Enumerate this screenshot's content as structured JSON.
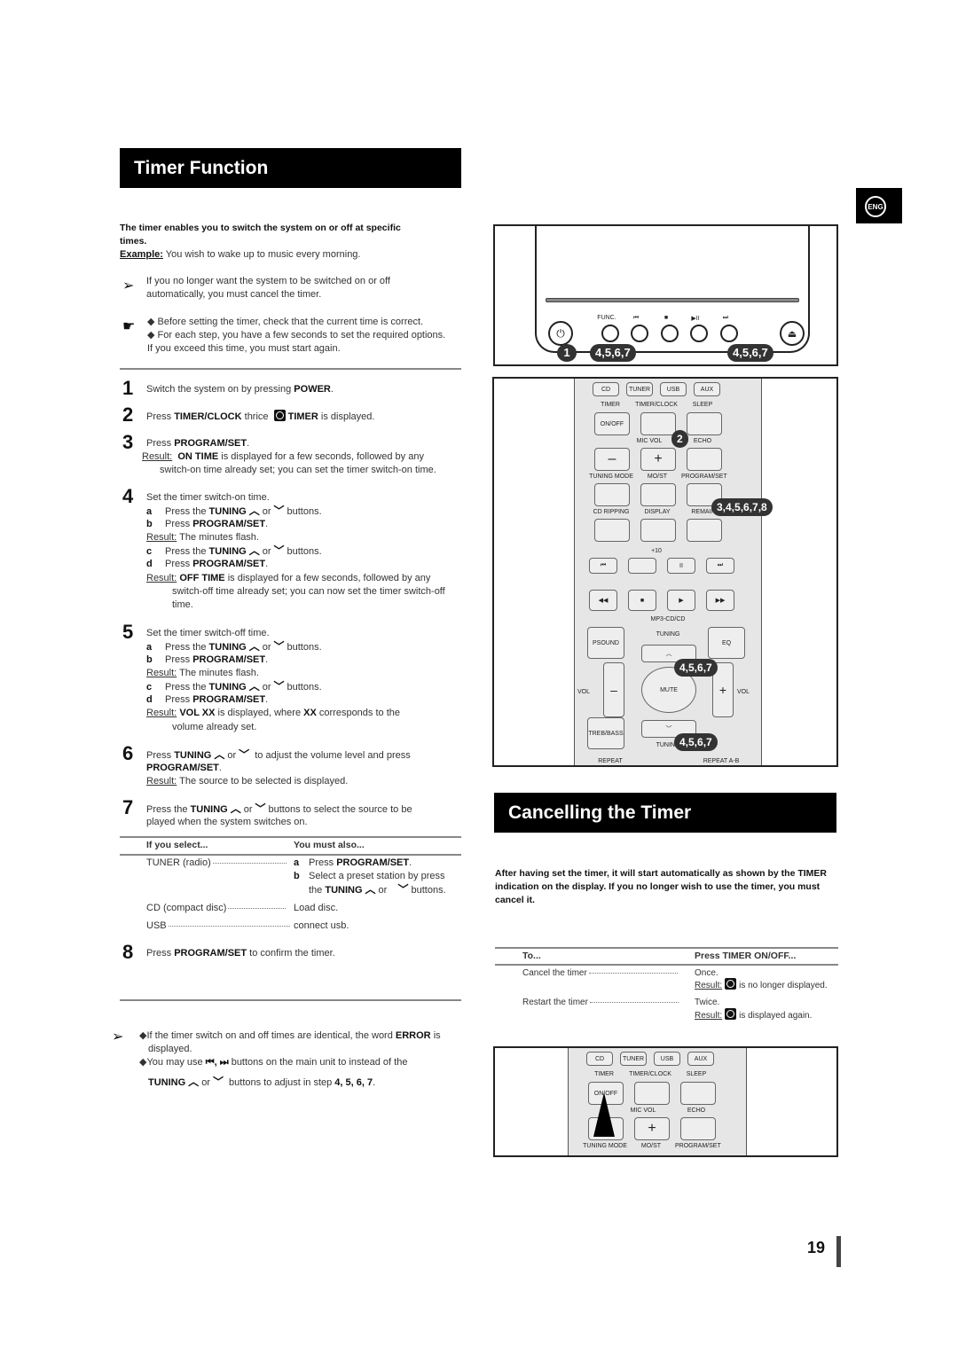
{
  "timer_function": {
    "title": "Timer Function",
    "intro_bold": "The timer enables you to switch the system on or off at specific times.",
    "example_label": "Example:",
    "example_text": "You wish to wake up to music every morning.",
    "note_cancel": "If you no longer want the system to be switched on or off automatically, you must cancel the timer.",
    "tip_1": "Before setting the timer, check that the current time is correct.",
    "tip_2": "For each step, you have a few seconds to set the required options.",
    "tip_3": "If you exceed this time, you must start again.",
    "steps": {
      "s1": {
        "num": "1",
        "text_a": "Switch the system on by pressing ",
        "bold": "POWER",
        "text_b": "."
      },
      "s2": {
        "num": "2",
        "text_a": "Press ",
        "bold": "TIMER/CLOCK",
        "text_b": " thrice ",
        "bold2": "TIMER",
        "text_c": " is displayed."
      },
      "s3": {
        "num": "3",
        "text_a": "Press ",
        "bold": "PROGRAM/SET",
        "text_b": ".",
        "result_label": "Result:",
        "result_bold": "ON TIME",
        "result_text": " is displayed for a few seconds, followed by any",
        "result_text2": "switch-on time already set; you can set the timer switch-on time."
      },
      "s4": {
        "num": "4",
        "heading": "Set the timer switch-on time.",
        "a": "Press the ",
        "a_bold": "TUNING",
        "a_or": "or",
        "a_end": "buttons.",
        "b": "Press ",
        "b_bold": "PROGRAM/SET",
        "b_end": ".",
        "r1_label": "Result:",
        "r1_text": "The minutes flash.",
        "c": "Press the ",
        "c_bold": "TUNING",
        "c_or": "or",
        "c_end": "buttons.",
        "d": "Press ",
        "d_bold": "PROGRAM/SET",
        "d_end": ".",
        "r2_label": "Result:",
        "r2_bold": "OFF TIME",
        "r2_text": " is displayed for a few seconds, followed by any",
        "r2_text2": "switch-off time already set; you can now set the timer switch-off",
        "r2_text3": "time."
      },
      "s5": {
        "num": "5",
        "heading": "Set the timer switch-off time.",
        "a": "Press the ",
        "a_bold": "TUNING",
        "a_or": "or",
        "a_end": "buttons.",
        "b": "Press ",
        "b_bold": "PROGRAM/SET",
        "b_end": ".",
        "r1_label": "Result:",
        "r1_text": "The minutes flash.",
        "c": "Press the ",
        "c_bold": "TUNING",
        "c_or": "or",
        "c_end": "buttons.",
        "d": "Press ",
        "d_bold": "PROGRAM/SET",
        "d_end": ".",
        "r2_label": "Result:",
        "r2_bold": "VOL XX",
        "r2_text": " is displayed, where ",
        "r2_bold2": "XX",
        "r2_text_b": " corresponds to the",
        "r2_text2": "volume already set."
      },
      "s6": {
        "num": "6",
        "text_a": "Press ",
        "bold": "TUNING",
        "or": "or",
        "text_b": "to adjust the volume level and press",
        "bold2": "PROGRAM/SET",
        "text_c": ".",
        "result_label": "Result:",
        "result_text": "The source to be selected is displayed."
      },
      "s7": {
        "num": "7",
        "text_a": "Press the ",
        "bold": "TUNING",
        "or": "or",
        "text_b": "buttons to select the source to be",
        "text_c": "played when the system switches on."
      },
      "s8": {
        "num": "8",
        "text_a": "Press ",
        "bold": "PROGRAM/SET",
        "text_b": " to confirm the timer."
      }
    },
    "source_table": {
      "headers": [
        "If you select...",
        "You must also..."
      ],
      "rows": [
        {
          "source": "TUNER (radio)",
          "a_label": "a",
          "a_text": "Press ",
          "a_bold": "PROGRAM/SET",
          "a_end": ".",
          "b_label": "b",
          "b_text": "Select a preset station by press",
          "b_text2_a": "the ",
          "b_bold": "TUNING",
          "b_or": "or",
          "b_end": "buttons."
        },
        {
          "source": "CD (compact disc)",
          "action": "Load disc."
        },
        {
          "source": "USB",
          "action": "connect usb."
        }
      ]
    },
    "footnote_1a": "If the timer switch on and off times are identical, the word ",
    "footnote_1b": "ERROR",
    "footnote_1c": " is",
    "footnote_1d": "displayed.",
    "footnote_2a": "You may use ",
    "footnote_2_icons": "⏮, ⏭",
    "footnote_2b": " buttons on the main unit to instead of the",
    "footnote_3_bold": "TUNING",
    "footnote_3_or": "or",
    "footnote_3b": "buttons to adjust in step ",
    "footnote_3_steps": "4, 5, 6, 7",
    "footnote_3_end": "."
  },
  "language_tab": "ENG",
  "main_unit_figure": {
    "labels": [
      "FUNC.",
      "⏮",
      "■",
      "▶II",
      "⏭"
    ],
    "badges": [
      "1",
      "4,5,6,7",
      "4,5,6,7"
    ]
  },
  "remote_figure": {
    "row1": [
      "CD",
      "TUNER",
      "USB",
      "AUX"
    ],
    "row2_labels": [
      "TIMER",
      "TIMER/CLOCK",
      "SLEEP"
    ],
    "on_off": "ON/OFF",
    "row3_labels": [
      "MIC VOL",
      "ECHO"
    ],
    "row4_labels": [
      "TUNING MODE",
      "MO/ST",
      "PROGRAM/SET"
    ],
    "row5_labels": [
      "CD RIPPING",
      "DISPLAY",
      "REMAIN"
    ],
    "plus10": "+10",
    "mp3": "MP3-CD/CD",
    "psound": "PSOUND",
    "tuning": "TUNING",
    "eq": "EQ",
    "vol": "VOL",
    "mute": "MUTE",
    "treb": "TREB/BASS",
    "tuning2": "TUNING",
    "repeat": "REPEAT",
    "repeat_ab": "REPEAT A-B",
    "badges": [
      "2",
      "3,4,5,6,7,8",
      "4,5,6,7",
      "4,5,6,7"
    ]
  },
  "cancelling": {
    "title": "Cancelling the Timer",
    "intro": "After having set the timer, it will start automatically as shown by the TIMER indication on the display. If you no longer wish to use the timer, you must cancel it.",
    "headers": [
      "To...",
      "Press TIMER ON/OFF..."
    ],
    "rows": [
      {
        "to": "Cancel the timer",
        "press": "Once.",
        "result_label": "Result:",
        "result_text": "is no longer displayed."
      },
      {
        "to": "Restart the timer",
        "press": "Twice.",
        "result_label": "Result:",
        "result_text": "is displayed again."
      }
    ]
  },
  "page_number": "19"
}
